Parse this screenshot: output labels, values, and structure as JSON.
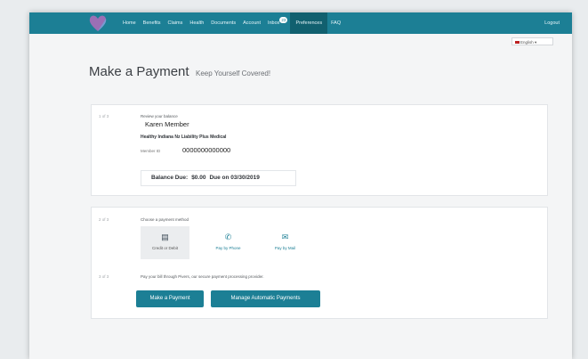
{
  "nav": {
    "items": [
      "Home",
      "Benefits",
      "Claims",
      "Health",
      "Documents",
      "Account",
      "Inbox",
      "Preferences",
      "FAQ"
    ],
    "inbox_badge": "23",
    "active": "Preferences",
    "logout": "Logout"
  },
  "language": {
    "selected": "English"
  },
  "page": {
    "title": "Make a Payment",
    "subtitle": "Keep Yourself Covered!"
  },
  "step1": {
    "step_label": "1 of 3",
    "prompt": "Review your balance",
    "member_name": "Karen Member",
    "plan_name": "Healthy Indiana Nz Liability Plus Medical",
    "member_id_label": "Member ID",
    "member_id": "0000000000000",
    "balance_label": "Balance Due:",
    "balance_amount": "$0.00",
    "due_text": "Due on 03/30/2019"
  },
  "step2": {
    "step_label": "2 of 3",
    "prompt": "Choose a payment method",
    "methods": [
      {
        "label": "Credit or Debit",
        "icon": "credit-card-icon"
      },
      {
        "label": "Pay by Phone",
        "icon": "phone-icon"
      },
      {
        "label": "Pay by Mail",
        "icon": "mail-icon"
      }
    ]
  },
  "step3": {
    "step_label": "3 of 3",
    "prompt": "Pay your bill through Pivers, our secure payment processing provider.",
    "make_payment_label": "Make a Payment",
    "manage_label": "Manage Automatic Payments"
  },
  "colors": {
    "brand": "#1c7f95",
    "nav_active": "#11606f",
    "logo": "#9b6fb5"
  }
}
